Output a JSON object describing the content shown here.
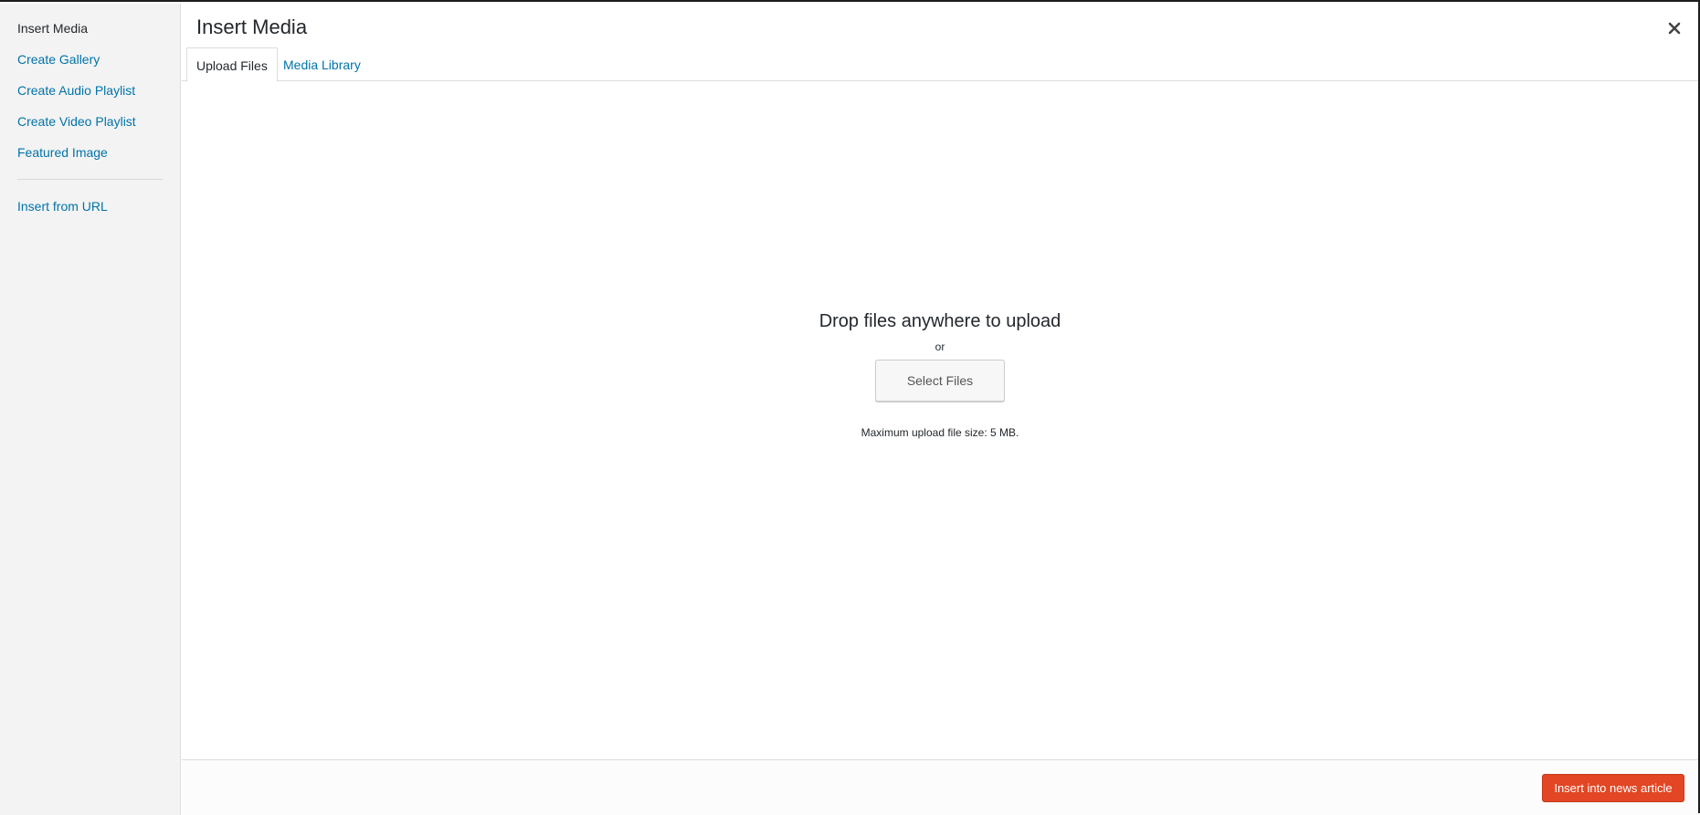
{
  "sidebar": {
    "items": [
      {
        "label": "Insert Media"
      },
      {
        "label": "Create Gallery"
      },
      {
        "label": "Create Audio Playlist"
      },
      {
        "label": "Create Video Playlist"
      },
      {
        "label": "Featured Image"
      },
      {
        "label": "Insert from URL"
      }
    ]
  },
  "header": {
    "title": "Insert Media",
    "close_icon": "close-icon"
  },
  "tabs": [
    {
      "label": "Upload Files",
      "active": true
    },
    {
      "label": "Media Library",
      "active": false
    }
  ],
  "upload": {
    "drop_text": "Drop files anywhere to upload",
    "or_text": "or",
    "select_button": "Select Files",
    "max_size_text": "Maximum upload file size: 5 MB."
  },
  "toolbar": {
    "insert_button": "Insert into news article"
  },
  "colors": {
    "link": "#0073aa",
    "accent_button": "#e24624",
    "sidebar_bg": "#f3f3f3"
  }
}
